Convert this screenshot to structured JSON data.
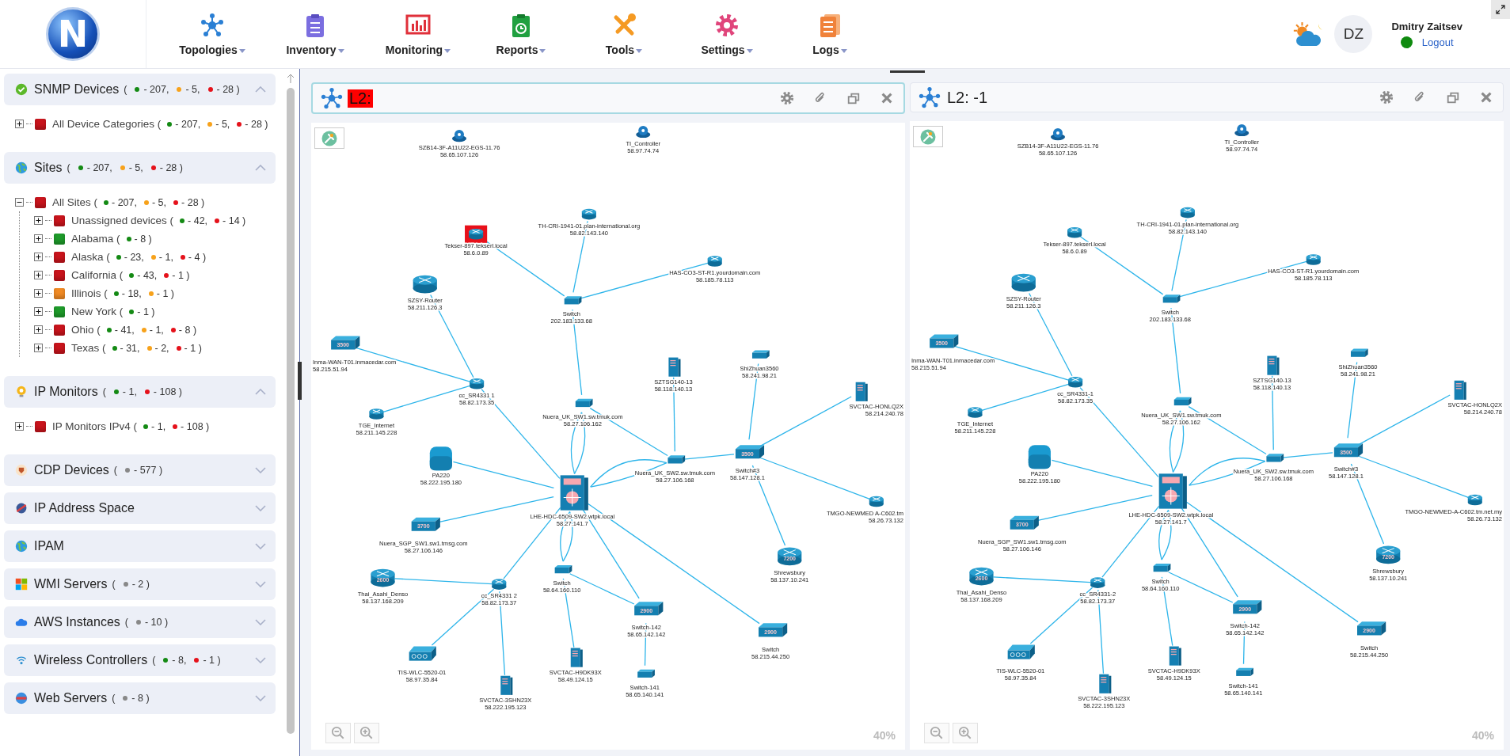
{
  "header": {
    "logo_letter": "N",
    "nav": [
      {
        "kind": "topologies",
        "label": "Topologies"
      },
      {
        "kind": "inventory",
        "label": "Inventory"
      },
      {
        "kind": "monitoring",
        "label": "Monitoring"
      },
      {
        "kind": "reports",
        "label": "Reports"
      },
      {
        "kind": "tools",
        "label": "Tools"
      },
      {
        "kind": "settings",
        "label": "Settings"
      },
      {
        "kind": "logs",
        "label": "Logs"
      }
    ],
    "user": {
      "initials": "DZ",
      "name": "Dmitry Zaitsev",
      "online": true,
      "logout": "Logout"
    }
  },
  "sidebar": {
    "sections": [
      {
        "kind": "snmp",
        "title": "SNMP Devices",
        "open": "(",
        "expanded": true,
        "counts": [
          {
            "color": "#148a14",
            "text": "- 207,"
          },
          {
            "color": "#f7a21b",
            "text": "- 5,"
          },
          {
            "color": "#e5121b",
            "text": "- 28 )"
          }
        ],
        "tree": [
          {
            "label": "All Device Categories (",
            "color": "#c8141c",
            "expanded": false,
            "counts": [
              {
                "color": "#148a14",
                "text": "- 207,"
              },
              {
                "color": "#f7a21b",
                "text": "- 5,"
              },
              {
                "color": "#e5121b",
                "text": "- 28 )"
              }
            ]
          }
        ]
      },
      {
        "kind": "sites",
        "title": "Sites",
        "open": "(",
        "expanded": true,
        "counts": [
          {
            "color": "#148a14",
            "text": "- 207,"
          },
          {
            "color": "#f7a21b",
            "text": "- 5,"
          },
          {
            "color": "#e5121b",
            "text": "- 28 )"
          }
        ],
        "tree": [
          {
            "label": "All Sites (",
            "color": "#c8141c",
            "expanded": true,
            "counts": [
              {
                "color": "#148a14",
                "text": "- 207,"
              },
              {
                "color": "#f7a21b",
                "text": "- 5,"
              },
              {
                "color": "#e5121b",
                "text": "- 28 )"
              }
            ],
            "children": [
              {
                "label": "Unassigned devices (",
                "color": "#c8141c",
                "expanded": false,
                "counts": [
                  {
                    "color": "#148a14",
                    "text": "- 42,"
                  },
                  {
                    "color": "#e5121b",
                    "text": "- 14 )"
                  }
                ]
              },
              {
                "label": "Alabama (",
                "color": "#1e9a2a",
                "expanded": false,
                "counts": [
                  {
                    "color": "#148a14",
                    "text": "- 8 )"
                  }
                ]
              },
              {
                "label": "Alaska (",
                "color": "#c8141c",
                "expanded": false,
                "counts": [
                  {
                    "color": "#148a14",
                    "text": "- 23,"
                  },
                  {
                    "color": "#f7a21b",
                    "text": "- 1,"
                  },
                  {
                    "color": "#e5121b",
                    "text": "- 4 )"
                  }
                ]
              },
              {
                "label": "California (",
                "color": "#c8141c",
                "expanded": false,
                "counts": [
                  {
                    "color": "#148a14",
                    "text": "- 43,"
                  },
                  {
                    "color": "#e5121b",
                    "text": "- 1 )"
                  }
                ]
              },
              {
                "label": "Illinois (",
                "color": "#f08a24",
                "expanded": false,
                "counts": [
                  {
                    "color": "#148a14",
                    "text": "- 18,"
                  },
                  {
                    "color": "#f7a21b",
                    "text": "- 1 )"
                  }
                ]
              },
              {
                "label": "New York (",
                "color": "#1e9a2a",
                "expanded": false,
                "counts": [
                  {
                    "color": "#148a14",
                    "text": "- 1 )"
                  }
                ]
              },
              {
                "label": "Ohio (",
                "color": "#c8141c",
                "expanded": false,
                "counts": [
                  {
                    "color": "#148a14",
                    "text": "- 41,"
                  },
                  {
                    "color": "#f7a21b",
                    "text": "- 1,"
                  },
                  {
                    "color": "#e5121b",
                    "text": "- 8 )"
                  }
                ]
              },
              {
                "label": "Texas (",
                "color": "#c8141c",
                "expanded": false,
                "counts": [
                  {
                    "color": "#148a14",
                    "text": "- 31,"
                  },
                  {
                    "color": "#f7a21b",
                    "text": "- 2,"
                  },
                  {
                    "color": "#e5121b",
                    "text": "- 1 )"
                  }
                ]
              }
            ]
          }
        ]
      },
      {
        "kind": "ipmon",
        "title": "IP Monitors",
        "open": "(",
        "expanded": true,
        "counts": [
          {
            "color": "#148a14",
            "text": "- 1,"
          },
          {
            "color": "#e5121b",
            "text": "- 108 )"
          }
        ],
        "tree": [
          {
            "label": "IP Monitors IPv4 (",
            "color": "#c8141c",
            "expanded": false,
            "counts": [
              {
                "color": "#148a14",
                "text": "- 1,"
              },
              {
                "color": "#e5121b",
                "text": "- 108 )"
              }
            ]
          }
        ]
      },
      {
        "kind": "cdp",
        "title": "CDP Devices",
        "open": "(",
        "expanded": false,
        "counts": [
          {
            "color": "#888888",
            "text": "- 577 )"
          }
        ]
      },
      {
        "kind": "ipspace",
        "title": "IP Address Space",
        "expanded": false
      },
      {
        "kind": "ipam",
        "title": "IPAM",
        "expanded": false
      },
      {
        "kind": "wmi",
        "title": "WMI Servers",
        "open": "(",
        "expanded": false,
        "counts": [
          {
            "color": "#888888",
            "text": "- 2 )"
          }
        ]
      },
      {
        "kind": "aws",
        "title": "AWS Instances",
        "open": "(",
        "expanded": false,
        "counts": [
          {
            "color": "#888888",
            "text": "- 10 )"
          }
        ]
      },
      {
        "kind": "wireless",
        "title": "Wireless Controllers",
        "open": "(",
        "expanded": false,
        "counts": [
          {
            "color": "#148a14",
            "text": "- 8,"
          },
          {
            "color": "#e5121b",
            "text": "- 1 )"
          }
        ]
      },
      {
        "kind": "web",
        "title": "Web Servers",
        "open": "(",
        "expanded": false,
        "counts": [
          {
            "color": "#888888",
            "text": "- 8 )"
          }
        ]
      }
    ]
  },
  "panels": [
    {
      "title": "L2:",
      "alert": true,
      "selected": true,
      "zoom": "40%",
      "nodes": [
        {
          "kind": "unknown",
          "name": "SZB14-3F-A11U22-EGS-11.76",
          "ip": "58.65.107.126",
          "alert": false
        },
        {
          "kind": "unknown",
          "name": "TI_Controller",
          "ip": "58.97.74.74",
          "alert": false
        },
        {
          "kind": "router",
          "name": "TH-CRI-1941-01.plan-international.org",
          "ip": "58.82.143.140",
          "alert": false
        },
        {
          "kind": "router",
          "name": "Tekser-897.tekserl.local",
          "ip": "58.6.0.89",
          "alert": true
        },
        {
          "kind": "router",
          "name": "HAS-CO3-ST-R1.yourdomain.com",
          "ip": "58.185.78.113",
          "alert": false
        },
        {
          "kind": "router-large",
          "name": "SZSY-Router",
          "ip": "58.211.126.3",
          "alert": false
        },
        {
          "kind": "switch",
          "name": "Switch",
          "ip": "202.183.133.68",
          "alert": false
        },
        {
          "kind": "switch-large",
          "model": "3500",
          "name": "Inma-WAN-T01.inmacedar.com",
          "ip": "58.215.51.94",
          "alert": false
        },
        {
          "kind": "router",
          "name": "cc_SR4331 1",
          "ip": "58.82.173.35",
          "alert": false
        },
        {
          "kind": "server",
          "name": "SZTSG140-13",
          "ip": "58.118.140.13",
          "alert": false
        },
        {
          "kind": "switch",
          "name": "ShiZhuan3560",
          "ip": "58.241.98.21",
          "alert": false
        },
        {
          "kind": "server",
          "name": "SVCTAC-HONLQ2X",
          "ip": "58.214.240.78",
          "alert": false
        },
        {
          "kind": "switch",
          "name": "Nuera_UK_SW1.sw.tmuk.com",
          "ip": "58.27.106.162",
          "alert": false
        },
        {
          "kind": "router",
          "name": "TGE_Internet",
          "ip": "58.211.145.228",
          "alert": false
        },
        {
          "kind": "firewall",
          "name": "PA220",
          "ip": "58.222.195.180",
          "alert": false
        },
        {
          "kind": "switch",
          "name": "Nuera_UK_SW2.sw.tmuk.com",
          "ip": "58.27.106.168",
          "alert": false
        },
        {
          "kind": "switch-large",
          "model": "3500",
          "name": "Switch#3",
          "ip": "58.147.128.1",
          "alert": false
        },
        {
          "kind": "core",
          "name": "LHE-HDC-6509-SW2.wtpk.local",
          "ip": "58.27.141.7",
          "alert": false
        },
        {
          "kind": "router",
          "name": "TMGO-NEWMED A-C602.tm",
          "ip": "58.26.73.132",
          "alert": false
        },
        {
          "kind": "switch-large",
          "model": "3700",
          "name": "Nuera_SGP_SW1.sw1.tmsg.com",
          "ip": "58.27.106.146",
          "alert": false
        },
        {
          "kind": "router-large",
          "model": "7200",
          "name": "Shrewsbury",
          "ip": "58.137.10.241",
          "alert": false
        },
        {
          "kind": "router-large",
          "model": "2600",
          "name": "Thai_Asahi_Denso",
          "ip": "58.137.168.209",
          "alert": false
        },
        {
          "kind": "router",
          "name": "cc_SR4331 2",
          "ip": "58.82.173.37",
          "alert": false
        },
        {
          "kind": "switch",
          "name": "Switch",
          "ip": "58.64.160.110",
          "alert": false
        },
        {
          "kind": "switch-large",
          "model": "2900",
          "name": "Switch-142",
          "ip": "58.65.142.142",
          "alert": false
        },
        {
          "kind": "switch-large",
          "model": "2900",
          "name": "Switch",
          "ip": "58.215.44.250",
          "alert": false
        },
        {
          "kind": "wlc",
          "name": "TIS-WLC-5520-01",
          "ip": "58.97.35.84",
          "alert": false
        },
        {
          "kind": "server",
          "name": "SVCTAC-H9DK93X",
          "ip": "58.49.124.15",
          "alert": false
        },
        {
          "kind": "switch",
          "name": "Switch-141",
          "ip": "58.65.140.141",
          "alert": false
        },
        {
          "kind": "server",
          "name": "SVCTAC-3SHN23X",
          "ip": "58.222.195.123",
          "alert": false
        }
      ]
    },
    {
      "title": "L2: -1",
      "alert": false,
      "selected": false,
      "zoom": "40%",
      "nodes": [
        {
          "kind": "unknown",
          "name": "SZB14-3F-A11U22-EGS-11.76",
          "ip": "58.65.107.126",
          "alert": false
        },
        {
          "kind": "unknown",
          "name": "TI_Controller",
          "ip": "58.97.74.74",
          "alert": false
        },
        {
          "kind": "router",
          "name": "TH-CRI-1941-01.plan-international.org",
          "ip": "58.82.143.140",
          "alert": false
        },
        {
          "kind": "router",
          "name": "Tekser-897.tekserl.local",
          "ip": "58.6.0.89",
          "alert": false
        },
        {
          "kind": "router",
          "name": "HAS-CO3-ST-R1.yourdomain.com",
          "ip": "58.185.78.113",
          "alert": false
        },
        {
          "kind": "router-large",
          "name": "SZSY-Router",
          "ip": "58.211.126.3",
          "alert": false
        },
        {
          "kind": "switch",
          "name": "Switch",
          "ip": "202.183.133.68",
          "alert": false
        },
        {
          "kind": "switch-large",
          "model": "3500",
          "name": "Inma-WAN-T01.inmacedar.com",
          "ip": "58.215.51.94",
          "alert": false
        },
        {
          "kind": "router",
          "name": "cc_SR4331-1",
          "ip": "58.82.173.35",
          "alert": false
        },
        {
          "kind": "server",
          "name": "SZTSG140-13",
          "ip": "58.118.140.13",
          "alert": false
        },
        {
          "kind": "switch",
          "name": "ShiZhuan3560",
          "ip": "58.241.98.21",
          "alert": false
        },
        {
          "kind": "server",
          "name": "SVCTAC-HONLQ2X",
          "ip": "58.214.240.78",
          "alert": false
        },
        {
          "kind": "switch",
          "name": "Nuera_UK_SW1.sw.tmuk.com",
          "ip": "58.27.106.162",
          "alert": false
        },
        {
          "kind": "router",
          "name": "TGE_Internet",
          "ip": "58.211.145.228",
          "alert": false
        },
        {
          "kind": "firewall",
          "name": "PA220",
          "ip": "58.222.195.180",
          "alert": false
        },
        {
          "kind": "switch",
          "name": "Nuera_UK_SW2.sw.tmuk.com",
          "ip": "58.27.106.168",
          "alert": false
        },
        {
          "kind": "switch-large",
          "model": "3500",
          "name": "Switch#3",
          "ip": "58.147.128.1",
          "alert": false
        },
        {
          "kind": "core",
          "name": "LHE-HDC-6509-SW2.wtpk.local",
          "ip": "58.27.141.7",
          "alert": false
        },
        {
          "kind": "router",
          "name": "TMGO-NEWMED-A-C602.tm.net.my",
          "ip": "58.26.73.132",
          "alert": false
        },
        {
          "kind": "switch-large",
          "model": "3700",
          "name": "Nuera_SGP_SW1.sw1.tmsg.com",
          "ip": "58.27.106.146",
          "alert": false
        },
        {
          "kind": "router-large",
          "model": "7200",
          "name": "Shrewsbury",
          "ip": "58.137.10.241",
          "alert": false
        },
        {
          "kind": "router-large",
          "model": "2600",
          "name": "Thai_Asahi_Denso",
          "ip": "58.137.168.209",
          "alert": false
        },
        {
          "kind": "router",
          "name": "cc_SR4331-2",
          "ip": "58.82.173.37",
          "alert": false
        },
        {
          "kind": "switch",
          "name": "Switch",
          "ip": "58.64.160.110",
          "alert": false
        },
        {
          "kind": "switch-large",
          "model": "2900",
          "name": "Switch-142",
          "ip": "58.65.142.142",
          "alert": false
        },
        {
          "kind": "switch-large",
          "model": "2900",
          "name": "Switch",
          "ip": "58.215.44.250",
          "alert": false
        },
        {
          "kind": "wlc",
          "name": "TIS-WLC-5520-01",
          "ip": "58.97.35.84",
          "alert": false
        },
        {
          "kind": "server",
          "name": "SVCTAC-H9DK93X",
          "ip": "58.49.124.15",
          "alert": false
        },
        {
          "kind": "switch",
          "name": "Switch-141",
          "ip": "58.65.140.141",
          "alert": false
        },
        {
          "kind": "server",
          "name": "SVCTAC-3SHN23X",
          "ip": "58.222.195.123",
          "alert": false
        }
      ]
    }
  ]
}
